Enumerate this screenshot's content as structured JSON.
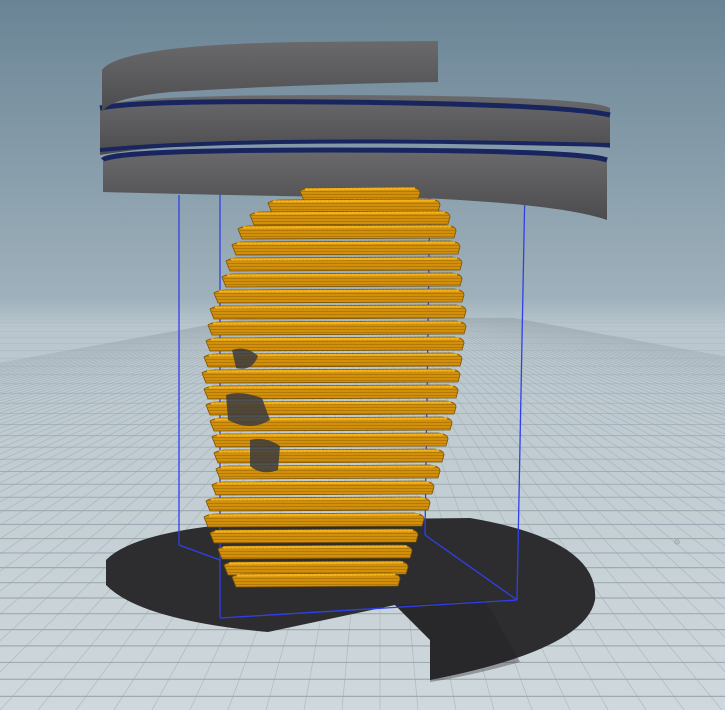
{
  "viewport": {
    "background_top": "#6f8a99",
    "background_horizon": "#b4c2ca",
    "floor_color": "#c9d3d8",
    "grid_color": "#9aa7ae",
    "grid_color_dark": "#8797a0"
  },
  "scene": {
    "geometry_color": "#d18f0a",
    "geometry_highlight": "#f2b21c",
    "geometry_shadow": "#7a5203",
    "ribbon_color": "#5e5e60",
    "ribbon_edge": "#1e2e6b",
    "disc_color": "#2f2f31",
    "bounding_box_color": "#2f3ce0"
  },
  "marker": {
    "glyph": "⊙"
  }
}
